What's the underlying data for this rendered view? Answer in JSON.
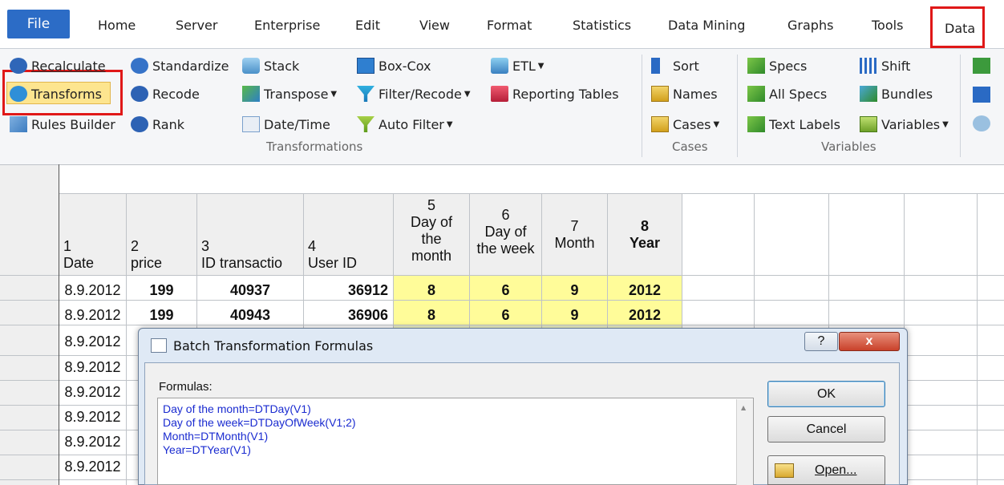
{
  "ribbon_tabs": {
    "file": "File",
    "home": "Home",
    "server": "Server",
    "enterprise": "Enterprise",
    "edit": "Edit",
    "view": "View",
    "format": "Format",
    "statistics": "Statistics",
    "data_mining": "Data Mining",
    "graphs": "Graphs",
    "tools": "Tools",
    "data": "Data"
  },
  "transformations": {
    "recalculate": "Recalculate",
    "transforms": "Transforms",
    "rules_builder": "Rules Builder",
    "standardize": "Standardize",
    "recode": "Recode",
    "rank": "Rank",
    "stack": "Stack",
    "transpose": "Transpose",
    "date_time": "Date/Time",
    "box_cox": "Box-Cox",
    "filter_recode": "Filter/Recode",
    "auto_filter": "Auto Filter",
    "etl": "ETL",
    "reporting_tables": "Reporting Tables",
    "group_label": "Transformations"
  },
  "cases": {
    "sort": "Sort",
    "names": "Names",
    "cases_btn": "Cases",
    "group_label": "Cases"
  },
  "variables": {
    "specs": "Specs",
    "all_specs": "All Specs",
    "text_labels": "Text Labels",
    "shift": "Shift",
    "bundles": "Bundles",
    "variables_btn": "Variables",
    "group_label": "Variables"
  },
  "grid": {
    "columns": [
      {
        "num": "1",
        "name": "Date"
      },
      {
        "num": "2",
        "name": "price"
      },
      {
        "num": "3",
        "name": "ID transactio"
      },
      {
        "num": "4",
        "name": "User ID"
      },
      {
        "num": "5",
        "name_lines": [
          "Day of",
          "the",
          "month"
        ]
      },
      {
        "num": "6",
        "name_lines": [
          "Day of",
          "the week"
        ]
      },
      {
        "num": "7",
        "name": "Month"
      },
      {
        "num": "8",
        "name": "Year"
      }
    ],
    "rows": [
      [
        "8.9.2012",
        "199",
        "40937",
        "36912",
        "8",
        "6",
        "9",
        "2012"
      ],
      [
        "8.9.2012",
        "199",
        "40943",
        "36906",
        "8",
        "6",
        "9",
        "2012"
      ],
      [
        "8.9.2012"
      ],
      [
        "8.9.2012"
      ],
      [
        "8.9.2012"
      ],
      [
        "8.9.2012"
      ],
      [
        "8.9.2012"
      ],
      [
        "8.9.2012"
      ]
    ]
  },
  "dialog": {
    "title": "Batch Transformation Formulas",
    "formulas_label": "Formulas:",
    "formulas": [
      "Day of the month=DTDay(V1)",
      "Day of the week=DTDayOfWeek(V1;2)",
      "Month=DTMonth(V1)",
      "Year=DTYear(V1)"
    ],
    "ok": "OK",
    "cancel": "Cancel",
    "open": "Open...",
    "help_glyph": "?",
    "close_glyph": "x"
  },
  "colors": {
    "file_tab": "#2c6cc6",
    "highlight_red": "#e01818",
    "selected_button": "#fde58f",
    "computed_columns": "#fffc99",
    "formula_text": "#1a2bd0"
  }
}
